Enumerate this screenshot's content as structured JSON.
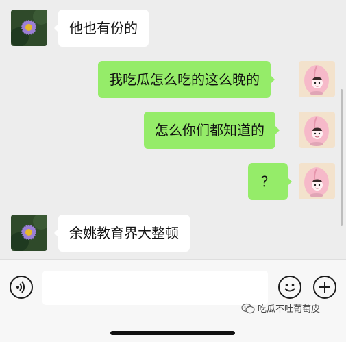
{
  "messages": [
    {
      "side": "left",
      "text": "他也有份的",
      "avatar": "flower-avatar"
    },
    {
      "side": "right",
      "text": "我吃瓜怎么吃的这么晚的",
      "avatar": "peach-avatar"
    },
    {
      "side": "right",
      "text": "怎么你们都知道的",
      "avatar": "peach-avatar"
    },
    {
      "side": "right",
      "text": "？",
      "avatar": "peach-avatar"
    },
    {
      "side": "left",
      "text": "余姚教育界大整顿",
      "avatar": "flower-avatar"
    }
  ],
  "input_bar": {
    "voice_icon": "voice-icon",
    "text_value": "",
    "emoji_icon": "emoji-icon",
    "plus_icon": "plus-icon"
  },
  "watermark": {
    "text": "吃瓜不吐葡萄皮",
    "icon": "wechat-icon"
  },
  "colors": {
    "background": "#ededed",
    "bubble_right": "#95ec69",
    "bubble_left": "#ffffff"
  }
}
